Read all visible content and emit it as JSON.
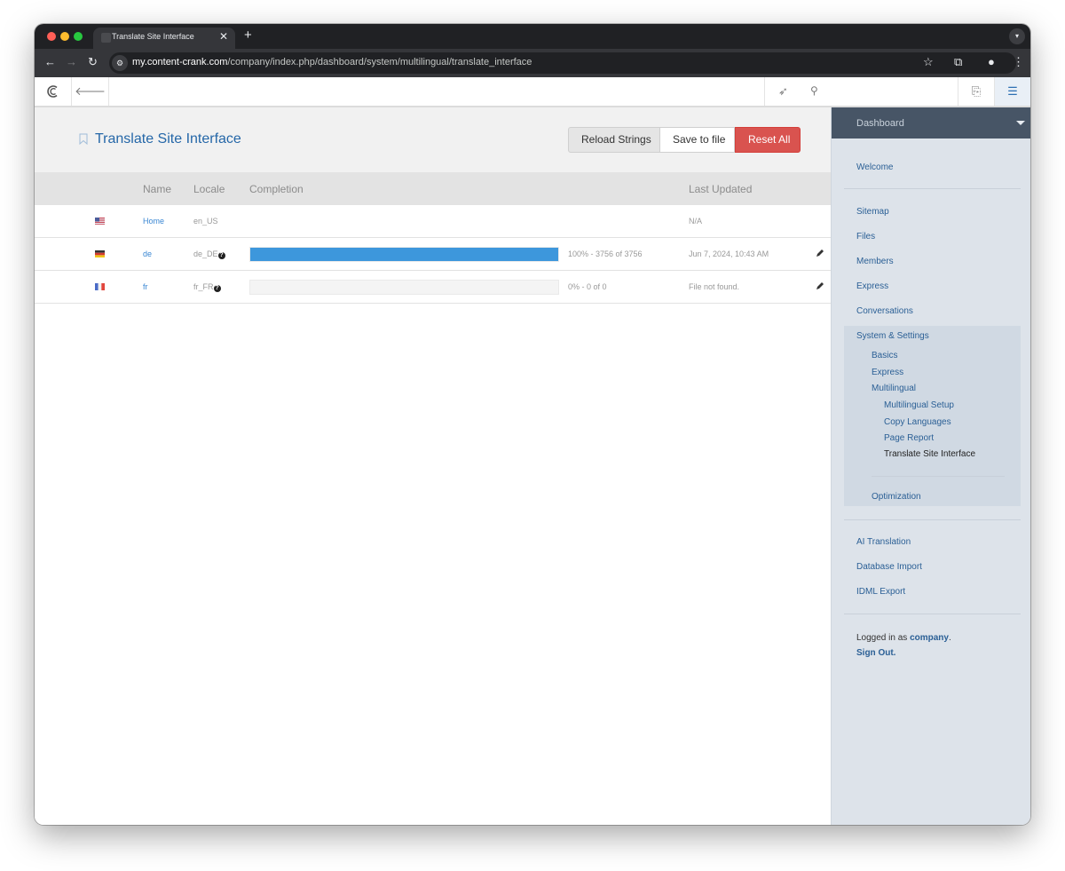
{
  "browser": {
    "tab_title": "Translate Site Interface",
    "tab_close": "✕",
    "new_tab": "+",
    "url_host": "my.content-crank.com",
    "url_path": "/company/index.php/dashboard/system/multilingual/translate_interface"
  },
  "page": {
    "title": "Translate Site Interface",
    "buttons": {
      "reload": "Reload Strings",
      "save": "Save to file",
      "reset": "Reset All"
    },
    "columns": {
      "name": "Name",
      "locale": "Locale",
      "completion": "Completion",
      "last_updated": "Last Updated"
    },
    "rows": [
      {
        "flag": "us-flag",
        "name": "Home",
        "locale": "en_US",
        "has_help": false,
        "progress": null,
        "completion_text": "",
        "updated": "N/A",
        "editable": false
      },
      {
        "flag": "de-flag",
        "name": "de",
        "locale": "de_DE",
        "has_help": true,
        "progress": 1.0,
        "completion_text": "100% - 3756 of 3756",
        "updated": "Jun 7, 2024, 10:43 AM",
        "editable": true
      },
      {
        "flag": "fr-flag",
        "name": "fr",
        "locale": "fr_FR",
        "has_help": true,
        "progress": 0.0,
        "completion_text": "0% - 0 of 0",
        "updated": "File not found.",
        "editable": true
      }
    ]
  },
  "sidebar": {
    "header": "Dashboard",
    "welcome": "Welcome",
    "items": [
      "Sitemap",
      "Files",
      "Members",
      "Express",
      "Conversations"
    ],
    "system": {
      "label": "System & Settings",
      "children": [
        "Basics",
        "Express",
        "Multilingual"
      ],
      "multilingual_children": [
        "Multilingual Setup",
        "Copy Languages",
        "Page Report",
        "Translate Site Interface"
      ],
      "optimization": "Optimization"
    },
    "extra_items": [
      "AI Translation",
      "Database Import",
      "IDML Export"
    ],
    "logged_in_prefix": "Logged in as",
    "logged_in_user": "company",
    "sign_out": "Sign Out."
  },
  "colors": {
    "accent": "#2567a8",
    "progress": "#3d97dc",
    "danger": "#d9534f",
    "sidebar_header": "#475566"
  }
}
